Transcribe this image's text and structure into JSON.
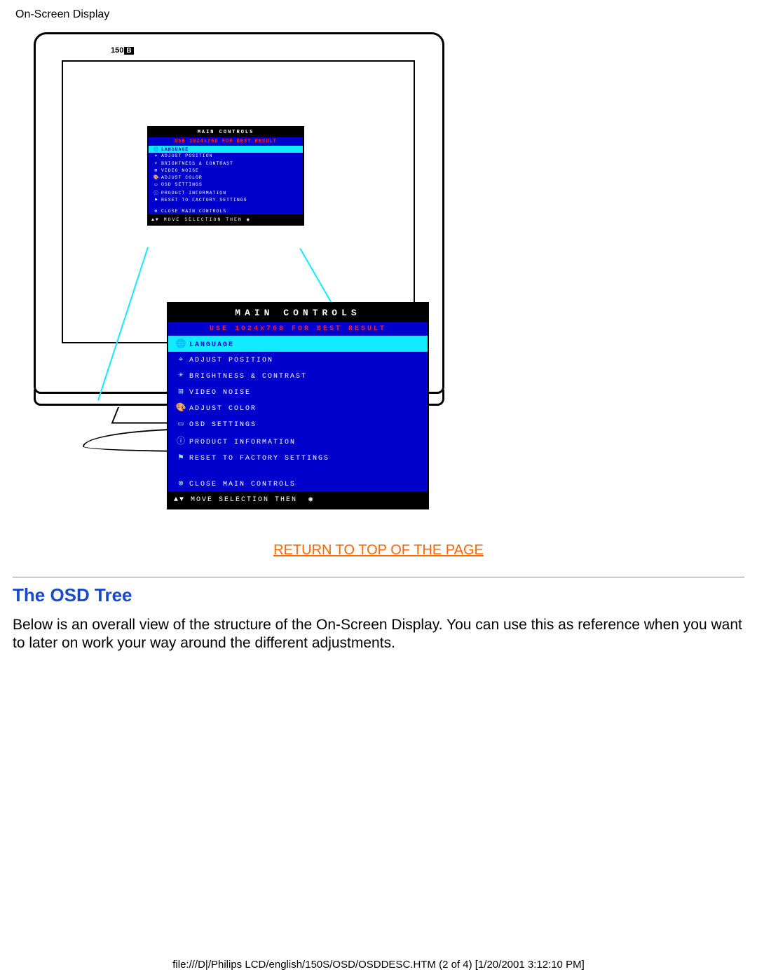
{
  "header": "On-Screen Display",
  "monitor": {
    "model_prefix": "150",
    "model_suffix": "B"
  },
  "osd": {
    "title": "MAIN CONTROLS",
    "hint": "USE 1024x768 FOR BEST RESULT",
    "items": [
      {
        "icon": "🌐",
        "label": "LANGUAGE",
        "selected": true
      },
      {
        "icon": "⌖",
        "label": "ADJUST POSITION"
      },
      {
        "icon": "☀",
        "label": "BRIGHTNESS & CONTRAST"
      },
      {
        "icon": "⊞",
        "label": "VIDEO NOISE"
      },
      {
        "icon": "🎨",
        "label": "ADJUST COLOR"
      },
      {
        "icon": "▭",
        "label": "OSD SETTINGS"
      },
      {
        "icon": "ⓘ",
        "label": "PRODUCT INFORMATION"
      },
      {
        "icon": "⚑",
        "label": "RESET TO FACTORY SETTINGS"
      }
    ],
    "close": {
      "icon": "⊗",
      "label": "CLOSE MAIN CONTROLS"
    },
    "footer_prefix": "▲▼",
    "footer_text": "MOVE SELECTION THEN",
    "footer_suffix": "◉"
  },
  "top_link": "RETURN TO TOP OF THE PAGE",
  "section_title": "The OSD Tree",
  "section_body": "Below is an overall view of the structure of the On-Screen Display. You can use this as reference when you want to later on work your way around the different adjustments.",
  "footer_path": "file:///D|/Philips LCD/english/150S/OSD/OSDDESC.HTM (2 of 4) [1/20/2001 3:12:10 PM]"
}
